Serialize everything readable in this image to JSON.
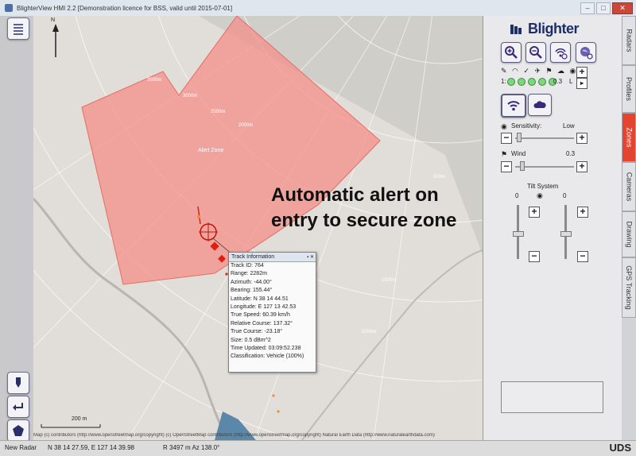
{
  "window": {
    "title": "BlighterView HMI 2.2 [Demonstration licence for BSS, valid until 2015-07-01]"
  },
  "map": {
    "north_label": "N",
    "zone_label": "Alert Zone",
    "scale_label": "200 m",
    "attribution": "Map (c) contributors (http://www.openstreetmap.org/copyright) (c) OpenStreetMap contributors (http://www.openstreetmap.org/copyright) Natural Earth Data (http://www.naturalearthdata.com)",
    "ring_labels": [
      "3500m",
      "3000m",
      "2500m",
      "2000m",
      "2000m",
      "1500m",
      "1000m",
      "500m"
    ],
    "colors": {
      "zone_fill": "#f48f8a",
      "track": "#e01f12",
      "coverage": "#c9c9c4"
    }
  },
  "annotation": {
    "line1": "Automatic alert on",
    "line2": "entry to secure zone"
  },
  "track_info": {
    "title": "Track Information",
    "rows": [
      "Track ID: 764",
      "Range: 2282m",
      "Azimuth: -44.00°",
      "Bearing: 155.44°",
      "Latitude: N 38 14 44.51",
      "Longitude: E 127 13 42.53",
      "True Speed: 60.39 km/h",
      "Relative Course: 137.32°",
      "True Course: -23.18°",
      "Size: 0.5 dBm^2",
      "Time Updated: 03:09:52.238",
      "Classification: Vehicle (100%)"
    ]
  },
  "panel": {
    "brand": "Blighter",
    "status_row_label": "1:",
    "status_value": "0.3",
    "status_l": "L",
    "sensitivity_label": "Sensitivity:",
    "sensitivity_value": "Low",
    "wind_label": "Wind",
    "wind_value": "0.3",
    "tilt_label": "Tilt System",
    "tilt_left_value": "0",
    "tilt_right_value": "0"
  },
  "tabs": [
    {
      "label": "Radars",
      "active": false
    },
    {
      "label": "Profiles",
      "active": false
    },
    {
      "label": "Zones",
      "active": true
    },
    {
      "label": "Cameras",
      "active": false
    },
    {
      "label": "Drawing",
      "active": false
    },
    {
      "label": "GPS Tracking",
      "active": false
    }
  ],
  "status": {
    "radar": "New Radar",
    "coords": "N 38 14 27.59, E 127 14 39.98",
    "range_az": "R 3497 m  Az 138.0°",
    "brand": "UDS"
  }
}
